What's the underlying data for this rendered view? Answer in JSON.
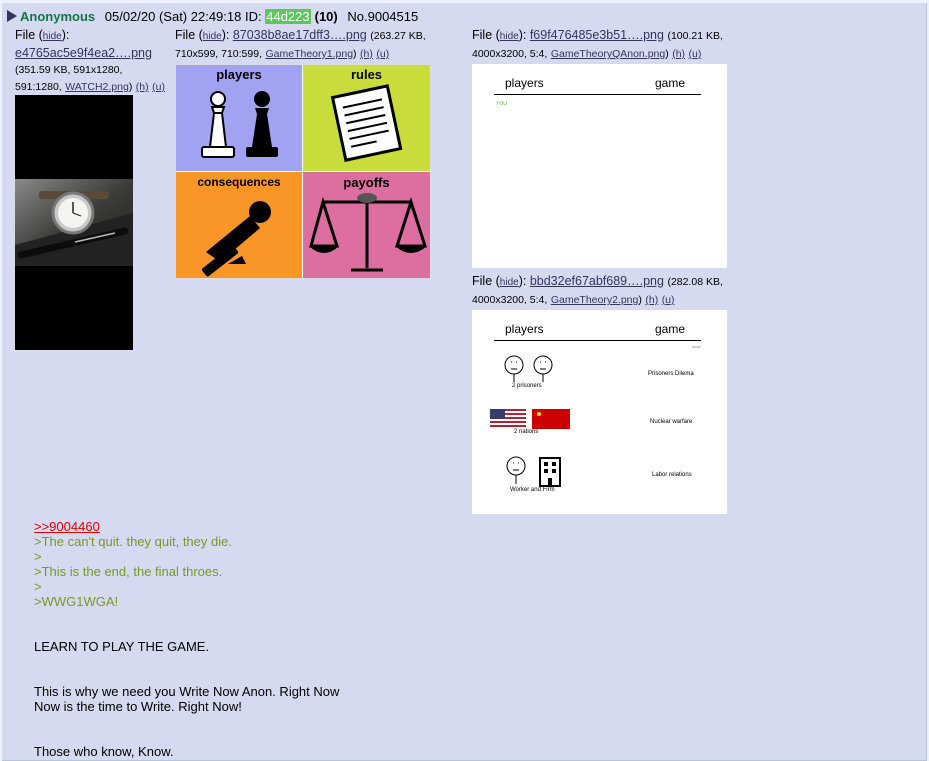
{
  "post": {
    "name": "Anonymous",
    "datetime": "05/02/20 (Sat) 22:49:18",
    "id_label": "ID:",
    "id": "44d223",
    "id_count": "(10)",
    "number": "No.9004515"
  },
  "file_label": "File",
  "hide_label": "hide",
  "h_label": "(h)",
  "u_label": "(u)",
  "files": [
    {
      "name": "e4765ac5e9f4ea2….png",
      "meta1": "(351.59 KB, 591x1280,",
      "meta2": "591:1280,",
      "orig": "WATCH2.png"
    },
    {
      "name": "87038b8ae17dff3….png",
      "meta1": "(263.27 KB,",
      "meta2": "710x599, 710:599,",
      "orig": "GameTheory1.png"
    },
    {
      "name": "f69f476485e3b51….png",
      "meta1": "(100.21 KB,",
      "meta2": "4000x3200, 5:4,",
      "orig": "GameTheoryQAnon.png"
    },
    {
      "name": "bbd32ef67abf689….png",
      "meta1": "(282.08 KB,",
      "meta2": "4000x3200, 5:4,",
      "orig": "GameTheory2.png"
    }
  ],
  "img1": {
    "players": "players",
    "rules": "rules",
    "consequences": "consequences",
    "payoffs": "payoffs",
    "colors": {
      "players": "#a2a2f2",
      "rules": "#c8dc3c",
      "consequences": "#fa9628",
      "payoffs": "#dc6ea0"
    }
  },
  "img2": {
    "players": "players",
    "game": "game",
    "you": "YOU"
  },
  "img3": {
    "players": "players",
    "game": "game",
    "hint": "nbox",
    "rows": [
      {
        "left": "2 prisoners",
        "right": "Prisoners Dilema"
      },
      {
        "left": "2 nations",
        "right": "Nuclear warfare"
      },
      {
        "left": "Worker and Firm",
        "right": "Labor relations"
      }
    ]
  },
  "message": {
    "backlink": ">>9004460",
    "quotes": [
      ">The can't quit. they quit, they die.",
      ">",
      ">This is the end, the final throes.",
      ">",
      ">WWG1WGA!"
    ],
    "p1": "LEARN TO PLAY THE GAME.",
    "p2a": "This is why we need you Write Now Anon. Right Now",
    "p2b": "Now is the time to Write. Right Now!",
    "p3": "Those who know, Know."
  }
}
